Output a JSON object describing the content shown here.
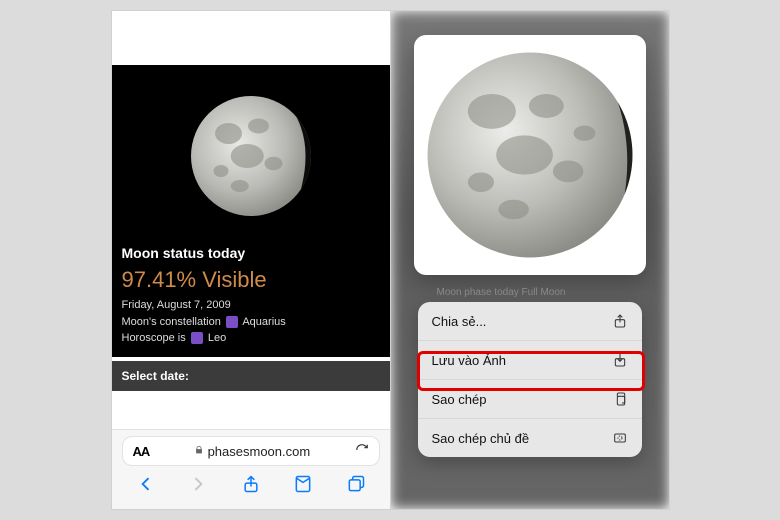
{
  "left": {
    "status_title": "Moon status today",
    "visibility": "97.41% Visible",
    "date": "Friday, August 7, 2009",
    "constellation_prefix": "Moon's constellation",
    "constellation_name": "Aquarius",
    "horoscope_prefix": "Horoscope is",
    "horoscope_name": "Leo",
    "select_date": "Select date:",
    "address_aa": "AA",
    "address_domain": "phasesmoon.com"
  },
  "right": {
    "caption": "Moon phase today Full Moon",
    "menu": {
      "share": "Chia sẻ...",
      "save_to_photos": "Lưu vào Ảnh",
      "copy": "Sao chép",
      "copy_subject": "Sao chép chủ đề"
    }
  }
}
